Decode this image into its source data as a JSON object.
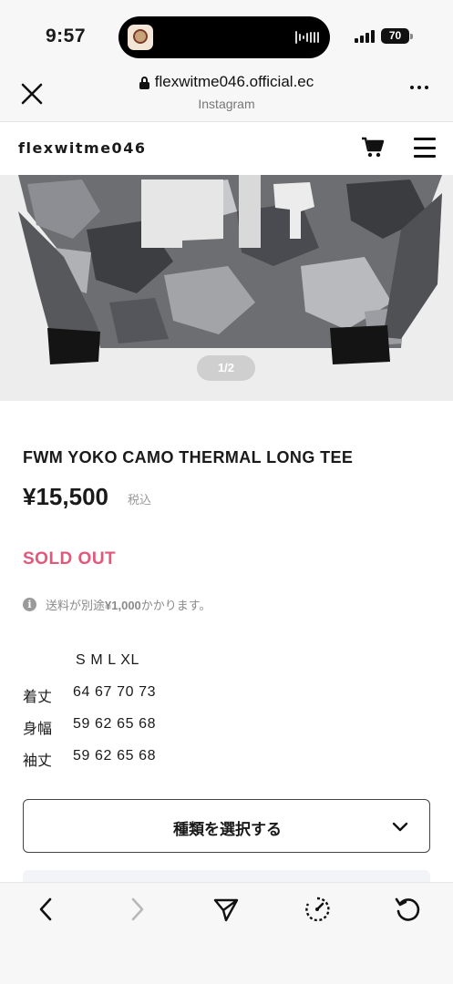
{
  "status_bar": {
    "time": "9:57",
    "battery": "70"
  },
  "browser": {
    "url": "flexwitme046.official.ec",
    "subtitle": "Instagram",
    "icons": [
      "close-icon",
      "lock-icon",
      "more-icon"
    ]
  },
  "store": {
    "name": "flexwitme046",
    "icons": [
      "cart-icon",
      "menu-icon"
    ]
  },
  "gallery": {
    "pager": "1/2",
    "image": "camo-long-tee-photo"
  },
  "product": {
    "title": "FWM YOKO CAMO THERMAL LONG TEE",
    "price": "¥15,500",
    "tax_note": "税込",
    "status": "SOLD OUT",
    "status_color": "#e2577a",
    "shipping_prefix": "送料が別途",
    "shipping_amount": "¥1,000",
    "shipping_suffix": "かかります。"
  },
  "size_chart": {
    "header": "S M L XL",
    "rows": [
      {
        "label": "着丈",
        "values": "64 67 70 73"
      },
      {
        "label": "身幅",
        "values": "59 62 65 68"
      },
      {
        "label": "袖丈",
        "values": "59 62 65 68"
      }
    ]
  },
  "variant_select": {
    "label": "種類を選択する"
  },
  "toolbar": {
    "icons": [
      "back-icon",
      "forward-icon",
      "share-icon",
      "speed-icon",
      "reload-icon"
    ]
  }
}
